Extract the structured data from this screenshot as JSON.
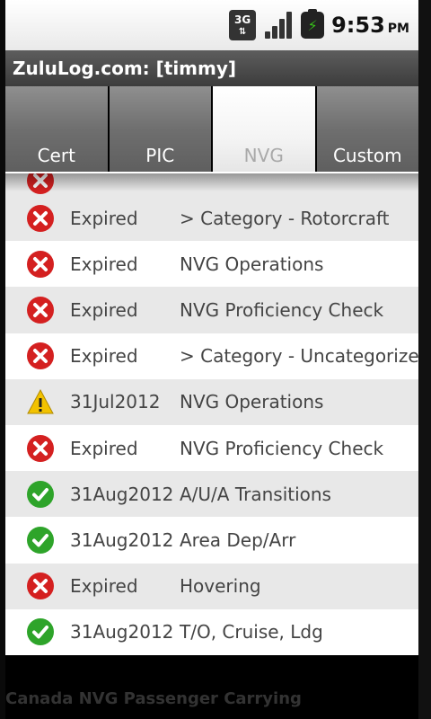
{
  "status_bar": {
    "network_label": "3G",
    "network_icon": "3g-data-icon",
    "signal_icon": "signal-strength-icon",
    "battery_icon": "battery-charging-icon",
    "time": "9:53",
    "ampm": "PM"
  },
  "app": {
    "title": "ZuluLog.com: [timmy]"
  },
  "tabs": [
    {
      "label": "Cert",
      "selected": false
    },
    {
      "label": "PIC",
      "selected": false
    },
    {
      "label": "NVG",
      "selected": true
    },
    {
      "label": "Custom",
      "selected": false
    }
  ],
  "rows": [
    {
      "status": "expired",
      "date": "Expired",
      "description": "> Category - Rotorcraft"
    },
    {
      "status": "expired",
      "date": "Expired",
      "description": "NVG Operations"
    },
    {
      "status": "expired",
      "date": "Expired",
      "description": "NVG Proficiency Check"
    },
    {
      "status": "expired",
      "date": "Expired",
      "description": "> Category - Uncategorized"
    },
    {
      "status": "warning",
      "date": "31Jul2012",
      "description": "NVG Operations"
    },
    {
      "status": "expired",
      "date": "Expired",
      "description": "NVG Proficiency Check"
    },
    {
      "status": "ok",
      "date": "31Aug2012",
      "description": "A/U/A Transitions"
    },
    {
      "status": "ok",
      "date": "31Aug2012",
      "description": "Area Dep/Arr"
    },
    {
      "status": "expired",
      "date": "Expired",
      "description": "Hovering"
    },
    {
      "status": "ok",
      "date": "31Aug2012",
      "description": "T/O, Cruise, Ldg"
    }
  ],
  "colors": {
    "expired": "#d42020",
    "warning": "#f2c200",
    "ok": "#2ea42a"
  },
  "footer": {
    "partial_label": "Canada NVG Passenger Carrying"
  }
}
